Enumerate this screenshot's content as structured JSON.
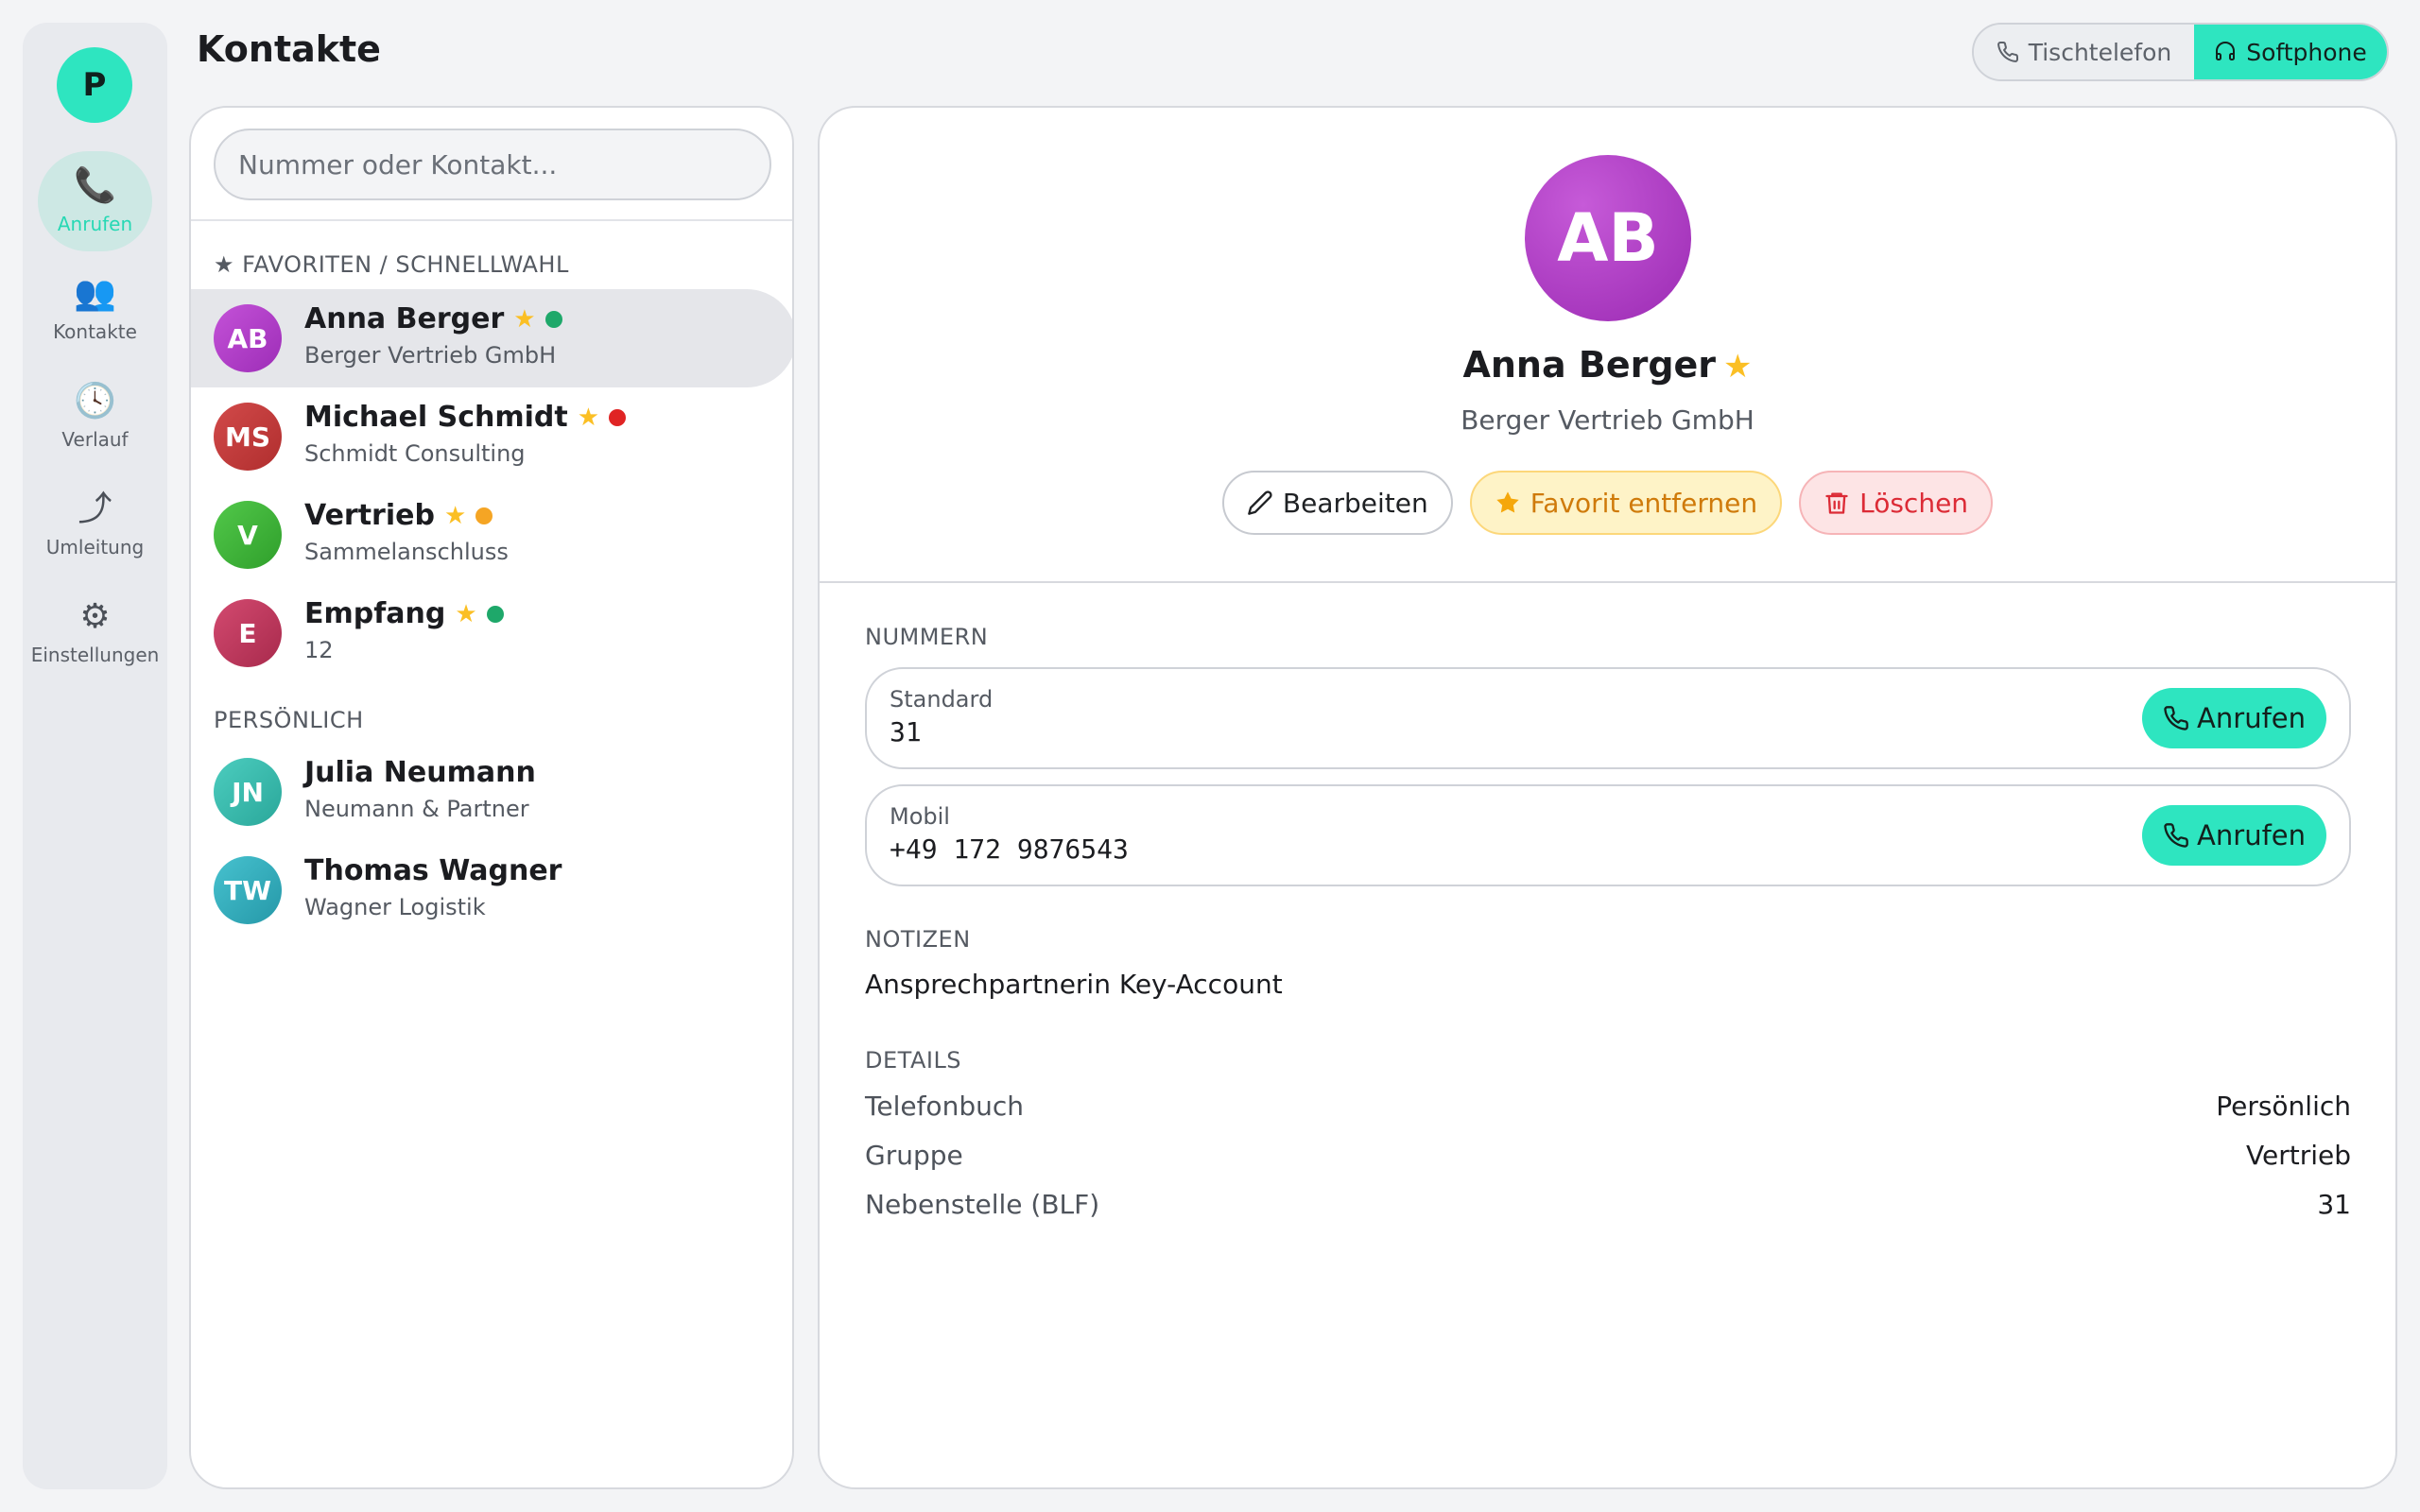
{
  "sidebar": {
    "user_initial": "P",
    "items": [
      {
        "label": "Anrufen",
        "icon": "📞"
      },
      {
        "label": "Kontakte",
        "icon": "👥"
      },
      {
        "label": "Verlauf",
        "icon": "🕓"
      },
      {
        "label": "Umleitung",
        "icon": "⤴"
      },
      {
        "label": "Einstellungen",
        "icon": "⚙"
      }
    ]
  },
  "header": {
    "title": "Kontakte",
    "mode_desk": "Tischtelefon",
    "mode_soft": "Softphone"
  },
  "search": {
    "placeholder": "Nummer oder Kontakt..."
  },
  "contacts": {
    "favorites_heading": "★ FAVORITEN / SCHNELLWAHL",
    "personal_heading": "PERSÖNLICH",
    "favorites": [
      {
        "initials": "AB",
        "name": "Anna Berger",
        "sub": "Berger Vertrieb GmbH",
        "status_color": "#1ea86a",
        "avatar_color": "#b23fcc"
      },
      {
        "initials": "MS",
        "name": "Michael Schmidt",
        "sub": "Schmidt Consulting",
        "status_color": "#e02424",
        "avatar_color": "#c53a3a"
      },
      {
        "initials": "V",
        "name": "Vertrieb",
        "sub": "Sammelanschluss",
        "status_color": "#f5a524",
        "avatar_color": "#3fb83a"
      },
      {
        "initials": "E",
        "name": "Empfang",
        "sub": "12",
        "status_color": "#1ea86a",
        "avatar_color": "#c0385e"
      }
    ],
    "personal": [
      {
        "initials": "JN",
        "name": "Julia Neumann",
        "sub": "Neumann & Partner",
        "avatar_color": "#3bbcaf"
      },
      {
        "initials": "TW",
        "name": "Thomas Wagner",
        "sub": "Wagner Logistik",
        "avatar_color": "#34aebe"
      }
    ]
  },
  "detail": {
    "initials": "AB",
    "name": "Anna Berger",
    "company": "Berger Vertrieb GmbH",
    "edit_label": "Bearbeiten",
    "fav_label": "Favorit entfernen",
    "delete_label": "Löschen",
    "numbers_heading": "NUMMERN",
    "numbers": [
      {
        "type": "Standard",
        "value": "31",
        "call_label": "Anrufen"
      },
      {
        "type": "Mobil",
        "value": "+49 172 9876543",
        "call_label": "Anrufen"
      }
    ],
    "notes_heading": "NOTIZEN",
    "notes": "Ansprechpartnerin Key-Account",
    "details_heading": "DETAILS",
    "details": [
      {
        "key": "Telefonbuch",
        "value": "Persönlich"
      },
      {
        "key": "Gruppe",
        "value": "Vertrieb"
      },
      {
        "key": "Nebenstelle (BLF)",
        "value": "31"
      }
    ]
  }
}
